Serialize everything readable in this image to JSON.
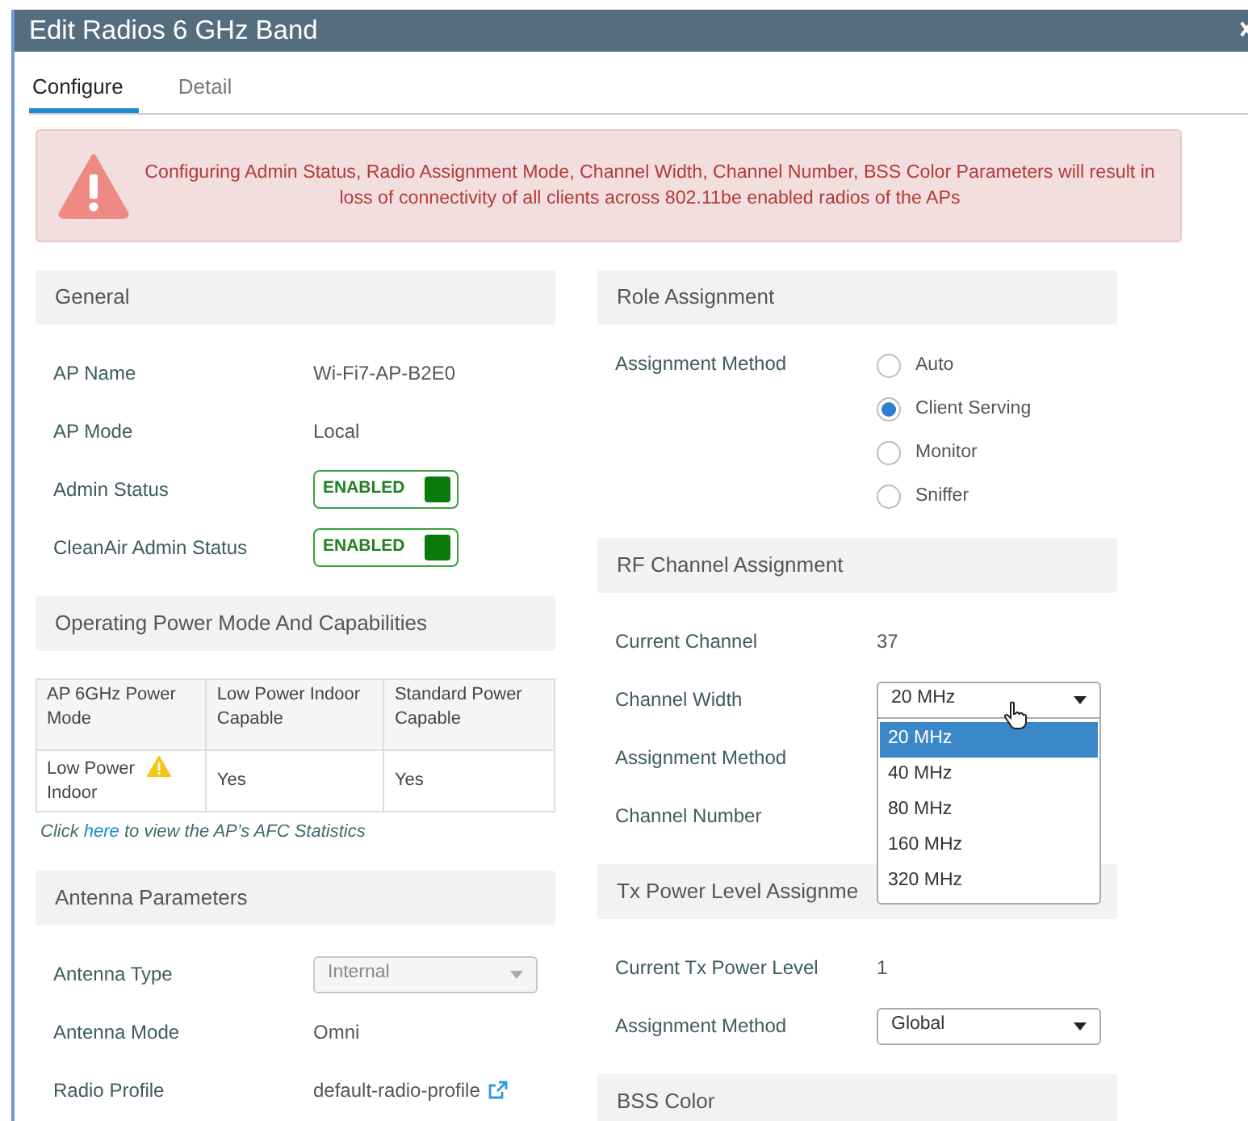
{
  "window": {
    "title": "Edit Radios 6 GHz Band"
  },
  "tabs": [
    {
      "label": "Configure",
      "selected": true
    },
    {
      "label": "Detail",
      "selected": false
    }
  ],
  "alert": {
    "message": "Configuring Admin Status, Radio Assignment Mode, Channel Width, Channel Number, BSS Color Parameters will result in loss of connectivity of all clients across 802.11be enabled radios of the APs"
  },
  "left": [
    {
      "kind": "section",
      "title": "General",
      "fields": [
        {
          "kind": "text",
          "label": "AP Name",
          "value": "Wi-Fi7-AP-B2E0"
        },
        {
          "kind": "text",
          "label": "AP Mode",
          "value": "Local"
        },
        {
          "kind": "toggle",
          "label": "Admin Status",
          "value": "ENABLED",
          "on": true
        },
        {
          "kind": "toggle",
          "label": "CleanAir Admin Status",
          "value": "ENABLED",
          "on": true
        }
      ]
    },
    {
      "kind": "table",
      "title": "Operating Power Mode And Capabilities",
      "columns": [
        "AP 6GHz Power Mode",
        "Low Power Indoor Capable",
        "Standard Power Capable"
      ],
      "rows": [
        {
          "cells": [
            {
              "text": "Low Power Indoor",
              "warning": true
            },
            {
              "text": "Yes",
              "warning": false
            },
            {
              "text": "Yes",
              "warning": false
            }
          ]
        }
      ],
      "note": {
        "before": "Click ",
        "link": "here",
        "after": " to view the AP’s AFC Statistics"
      }
    },
    {
      "kind": "section",
      "title": "Antenna Parameters",
      "fields": [
        {
          "kind": "select",
          "label": "Antenna Type",
          "value": "Internal",
          "disabled": true
        },
        {
          "kind": "text",
          "label": "Antenna Mode",
          "value": "Omni"
        },
        {
          "kind": "link",
          "label": "Radio Profile",
          "value": "default-radio-profile"
        }
      ]
    }
  ],
  "right": [
    {
      "kind": "section",
      "title": "Role Assignment",
      "fields": [
        {
          "kind": "radio",
          "label": "Assignment Method",
          "options": [
            {
              "label": "Auto",
              "selected": false
            },
            {
              "label": "Client Serving",
              "selected": true
            },
            {
              "label": "Monitor",
              "selected": false
            },
            {
              "label": "Sniffer",
              "selected": false
            }
          ]
        }
      ]
    },
    {
      "kind": "section",
      "title": "RF Channel Assignment",
      "fields": [
        {
          "kind": "text",
          "label": "Current Channel",
          "value": "37"
        },
        {
          "kind": "select",
          "label": "Channel Width",
          "value": "20 MHz",
          "disabled": false,
          "expanded": true,
          "options": [
            {
              "label": "20 MHz",
              "selected": true
            },
            {
              "label": "40 MHz",
              "selected": false
            },
            {
              "label": "80 MHz",
              "selected": false
            },
            {
              "label": "160 MHz",
              "selected": false
            },
            {
              "label": "320 MHz",
              "selected": false
            }
          ]
        },
        {
          "kind": "label",
          "label": "Assignment Method"
        },
        {
          "kind": "label",
          "label": "Channel Number"
        }
      ]
    },
    {
      "kind": "section",
      "title": "Tx Power Level Assignme",
      "fields": [
        {
          "kind": "text",
          "label": "Current Tx Power Level",
          "value": "1"
        },
        {
          "kind": "select",
          "label": "Assignment Method",
          "value": "Global",
          "disabled": false,
          "expanded": false
        }
      ]
    },
    {
      "kind": "section",
      "title": "BSS Color"
    }
  ]
}
